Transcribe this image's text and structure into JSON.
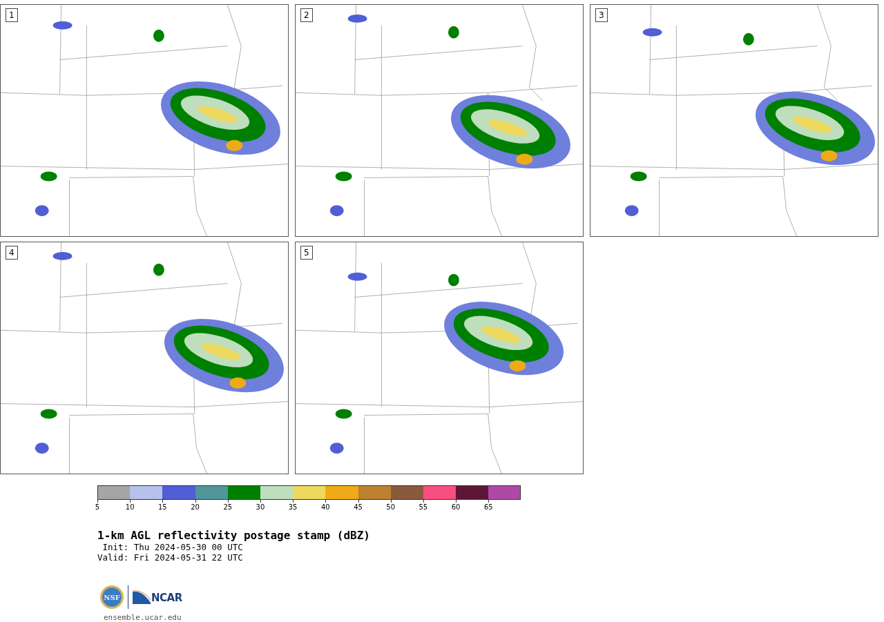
{
  "panels": [
    {
      "label": "1"
    },
    {
      "label": "2"
    },
    {
      "label": "3"
    },
    {
      "label": "4"
    },
    {
      "label": "5"
    }
  ],
  "colorbar": {
    "segments": [
      {
        "color": "#a5a5a5"
      },
      {
        "color": "#b6c2ec"
      },
      {
        "color": "#515ed6"
      },
      {
        "color": "#50969b"
      },
      {
        "color": "#008000"
      },
      {
        "color": "#bedebd"
      },
      {
        "color": "#eed95f"
      },
      {
        "color": "#efab17"
      },
      {
        "color": "#bb8130"
      },
      {
        "color": "#8a5a3e"
      },
      {
        "color": "#f64f80"
      },
      {
        "color": "#5e1637"
      },
      {
        "color": "#ae4aa5"
      }
    ],
    "ticks": [
      "5",
      "10",
      "15",
      "20",
      "25",
      "30",
      "35",
      "40",
      "45",
      "50",
      "55",
      "60",
      "65"
    ]
  },
  "title": "1-km AGL reflectivity postage stamp (dBZ)",
  "init": " Init: Thu 2024-05-30 00 UTC",
  "valid": "Valid: Fri 2024-05-31 22 UTC",
  "logos": {
    "nsf": "NSF",
    "ncar": "NCAR"
  },
  "site": "ensemble.ucar.edu"
}
